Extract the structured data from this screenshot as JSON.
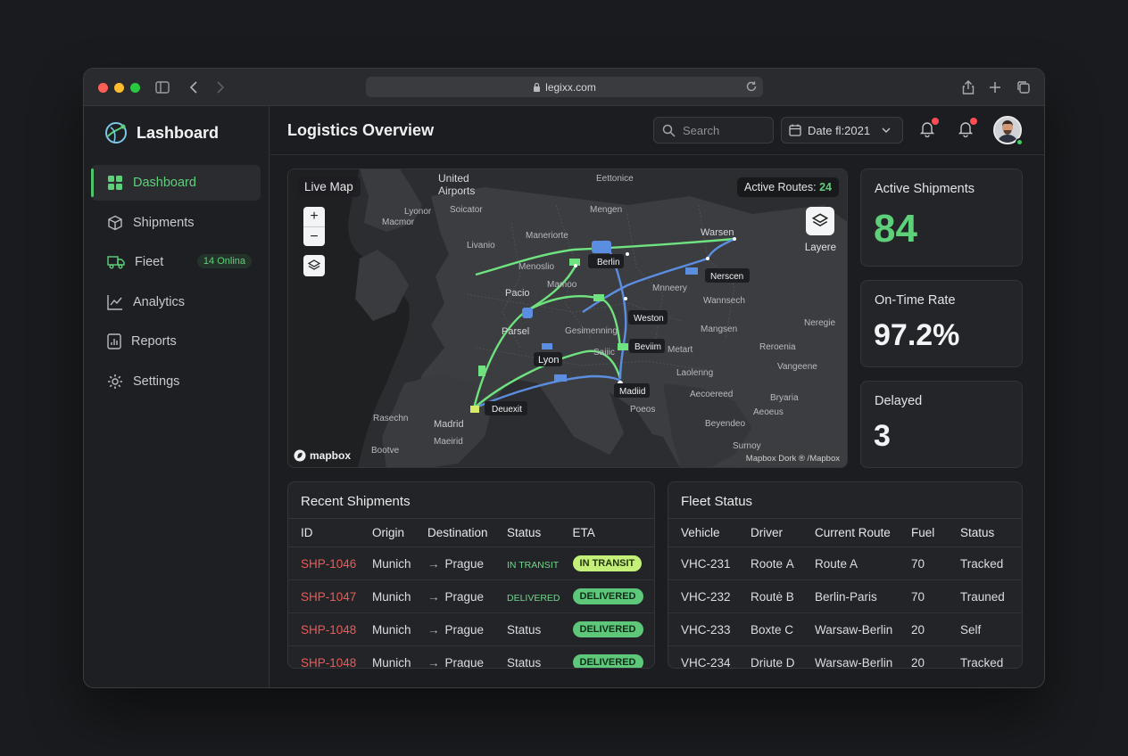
{
  "browser": {
    "url": "legixx.com"
  },
  "brand": {
    "name": "Lashboard"
  },
  "sidebar": {
    "items": [
      {
        "label": "Dashboard",
        "icon": "grid-icon",
        "active": true
      },
      {
        "label": "Shipments",
        "icon": "box-icon"
      },
      {
        "label": "Fieet",
        "icon": "truck-icon",
        "badge": "14 Onlina"
      },
      {
        "label": "Analytics",
        "icon": "chart-icon"
      },
      {
        "label": "Reports",
        "icon": "report-icon"
      },
      {
        "label": "Settings",
        "icon": "gear-icon"
      }
    ]
  },
  "header": {
    "title": "Logistics Overview",
    "search_placeholder": "Search",
    "date_filter": "Date fl:2021"
  },
  "map": {
    "label": "Live Map",
    "active_routes_label": "Active Routes:",
    "active_routes_value": "24",
    "layers_label": "Layere",
    "logo": "mapbox",
    "attribution": "Mapbox Dork ® /Mapbox",
    "places": [
      "United",
      "Airports",
      "Eettonice",
      "Mengen",
      "Warsen",
      "Lyonor",
      "Soicator",
      "Macmor",
      "Livanio",
      "Maneriorte",
      "Menoslio",
      "Mamoo",
      "Pacio",
      "Parsel",
      "Mnneery",
      "Wannsech",
      "Mangsen",
      "Gesimenning",
      "Saiiic",
      "Metart",
      "Reroenia",
      "Vangeene",
      "Laolenng",
      "Aecoereed",
      "Bryaria",
      "Rosseo",
      "Aeoeus",
      "Beyendeo",
      "Poeos",
      "Rasechn",
      "Bootve",
      "Maeirid",
      "Surnoy",
      "Neregie"
    ],
    "cities": [
      "Berlin",
      "Lyon",
      "Weston",
      "Beviim",
      "Madiid",
      "Deuexit",
      "Nerscen",
      "Madrid"
    ]
  },
  "stats": {
    "active_shipments": {
      "label": "Active Shipments",
      "value": "84",
      "color": "#5fd07a"
    },
    "on_time_rate": {
      "label": "On-Time Rate",
      "value": "97.2%"
    },
    "delayed": {
      "label": "Delayed",
      "value": "3"
    }
  },
  "recent_shipments": {
    "title": "Recent Shipments",
    "columns": [
      "ID",
      "Origin",
      "Destination",
      "Status",
      "ETA"
    ],
    "rows": [
      {
        "id": "SHP-1046",
        "origin": "Munich",
        "destination": "Prague",
        "status": "IN TRANSIT",
        "eta": "IN TRANSIT"
      },
      {
        "id": "SHP-1047",
        "origin": "Munich",
        "destination": "Prague",
        "status": "DELIVERED",
        "eta": "DELIVERED"
      },
      {
        "id": "SHP-1048",
        "origin": "Munich",
        "destination": "Prague",
        "status": "Status",
        "eta": "DELIVERED"
      },
      {
        "id": "SHP-1048",
        "origin": "Munich",
        "destination": "Prague",
        "status": "Status",
        "eta": "DELIVERED"
      }
    ]
  },
  "fleet_status": {
    "title": "Fleet Status",
    "columns": [
      "Vehicle",
      "Driver",
      "Current Route",
      "Fuel",
      "Status"
    ],
    "rows": [
      {
        "vehicle": "VHC-231",
        "driver": "Rootе A",
        "route": "Route A",
        "fuel": "70",
        "status": "Tracked"
      },
      {
        "vehicle": "VHC-232",
        "driver": "Routė B",
        "route": "Berlin-Paris",
        "fuel": "70",
        "status": "Trauned"
      },
      {
        "vehicle": "VHC-233",
        "driver": "Boxte C",
        "route": "Warsaw-Berlin",
        "fuel": "20",
        "status": "Self"
      },
      {
        "vehicle": "VHC-234",
        "driver": "Driute D",
        "route": "Warsaw-Berlin",
        "fuel": "20",
        "status": "Tracked"
      }
    ]
  }
}
